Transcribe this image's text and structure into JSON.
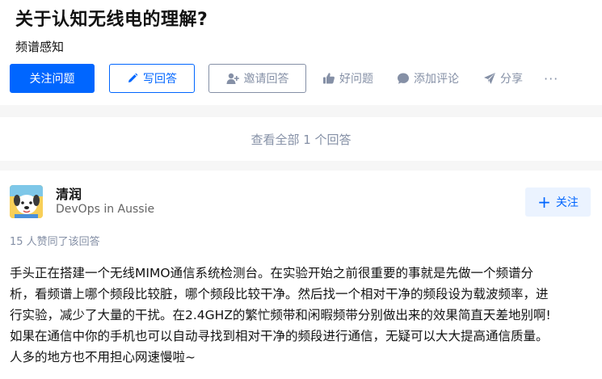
{
  "question": {
    "title": "关于认知无线电的理解?",
    "topic": "频谱感知"
  },
  "actions": {
    "follow_question": "关注问题",
    "write_answer": "写回答",
    "invite_answer": "邀请回答",
    "good_question": "好问题",
    "add_comment": "添加评论",
    "share": "分享",
    "more": "···"
  },
  "view_all": {
    "label": "查看全部 1 个回答"
  },
  "answer": {
    "author_name": "清润",
    "author_headline": "DevOps in Aussie",
    "follow_label": "关注",
    "votes_text": "15 人赞同了该回答",
    "lines": [
      "手头正在搭建一个无线MIMO通信系统检测台。在实验开始之前很重要的事就是先做一个频谱分",
      "析，看频谱上哪个频段比较脏，哪个频段比较干净。然后找一个相对干净的频段设为载波频率，进",
      "行实验，减少了大量的干扰。在2.4GHZ的繁忙频带和闲暇频带分别做出来的效果简直天差地别啊!",
      "如果在通信中你的手机也可以自动寻找到相对干净的频段进行通信，无疑可以大大提高通信质量。",
      "人多的地方也不用担心网速慢啦~"
    ]
  },
  "colors": {
    "brand_blue": "#0066ff",
    "muted_gray": "#8590a6",
    "page_bg": "#f6f6f6"
  }
}
